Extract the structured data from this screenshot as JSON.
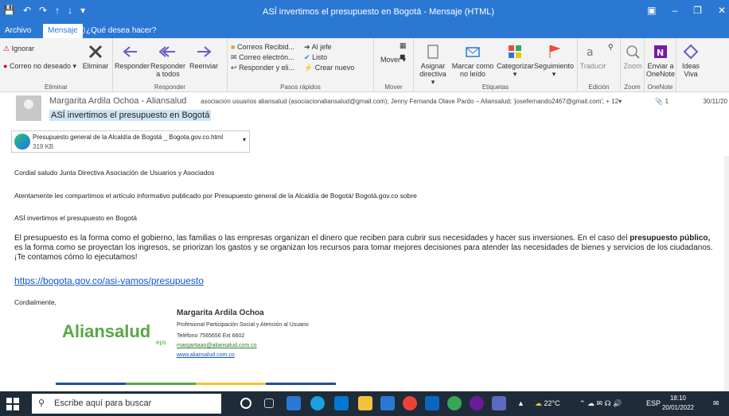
{
  "titlebar": {
    "title": "ASÍ invertimos el presupuesto en Bogotá - Mensaje (HTML)"
  },
  "menu": {
    "archivo": "Archivo",
    "mensaje": "Mensaje",
    "tell_me": "¿Qué desea hacer?"
  },
  "ribbon": {
    "ignorar": "Ignorar",
    "correo_no_deseado": "Correo no deseado",
    "eliminar": "Eliminar",
    "responder": "Responder",
    "responder_a_todos_1": "Responder",
    "responder_a_todos_2": "a todos",
    "reenviar": "Reenviar",
    "g_eliminar": "Eliminar",
    "g_responder": "Responder",
    "pr_correos_recibid": "Correos Recibid...",
    "pr_al_jefe": "Al jefe",
    "pr_correo_electron": "Correo electrón...",
    "pr_listo": "Listo",
    "pr_responder_y_eli": "Responder y eli...",
    "pr_crear_nuevo": "Crear nuevo",
    "g_pasos_rapidos": "Pasos rápidos",
    "mover": "Mover",
    "g_mover": "Mover",
    "asignar_1": "Asignar",
    "asignar_2": "directiva",
    "marcar_1": "Marcar como",
    "marcar_2": "no leído",
    "categorizar": "Categorizar",
    "seguimiento": "Seguimiento",
    "g_etiquetas": "Etiquetas",
    "traducir": "Traducir",
    "g_edicion": "Edición",
    "zoom": "Zoom",
    "g_zoom": "Zoom",
    "enviar_1": "Enviar a",
    "enviar_2": "OneNote",
    "g_onenote": "OneNote",
    "ideas_1": "Ideas",
    "ideas_2": "Viva"
  },
  "message": {
    "sender": "Margarita Ardila Ochoa - Aliansalud",
    "recipients": "asociacion usuarios aliansalud (asociacionaliansalud@gmail.com); Jenny Fernanda Olave Pardo – Aliansalud; 'josefernando2467@gmail.com'; + 12",
    "attach_count": "1",
    "date": "30/11/20",
    "subject": "ASÍ invertimos el presupuesto en Bogotá",
    "attachment_name": "Presupuesto general de la Alcaldía de Bogotá _ Bogota.gov.co.html",
    "attachment_size": "319 KB"
  },
  "body": {
    "p1": "Cordial saludo Junta Directiva Asociación de Usuarios y Asociados",
    "p2": "Atentamente les compartimos el artículo  informativo publicado por Presupuesto general de la Alcaldía de Bogotá/ Bogotá.gov.co sobre",
    "p3": "ASÍ invertimos el presupuesto en Bogotá",
    "p4a": "El presupuesto es la forma como el gobierno, las familias o las empresas organizan el dinero que reciben para cubrir sus necesidades y hacer sus inversiones. En el caso del ",
    "p4b": "presupuesto público,",
    "p4c": " es la forma como se proyectan los ingresos, se priorizan los gastos y se organizan los recursos para tomar mejores decisiones para atender las necesidades de bienes y servicios de los ciudadanos. ¡Te contamos cómo lo ejecutamos!",
    "link": "https://bogota.gov.co/asi-vamos/presupuesto",
    "closing": "Cordialmente,",
    "sig_name": "Margarita Ardila Ochoa",
    "sig_title": "Profesional Participación Social y Atención al Usuario",
    "sig_phone": "Teléfono 7565656 Ext 6602",
    "sig_email": "margaritaao@aliansalud.com.co",
    "sig_web": "www.aliansalud.com.co",
    "logo": "Aliansalud",
    "logo_eps": "eps"
  },
  "taskbar": {
    "search": "Escribe aquí para buscar",
    "temp": "22°C",
    "lang": "ESP",
    "time": "18:10",
    "date": "20/01/2022"
  },
  "colors": {
    "accent": "#2b78d4",
    "taskbar": "#1f2b38",
    "logo_green": "#57a845",
    "link": "#1155cc"
  }
}
